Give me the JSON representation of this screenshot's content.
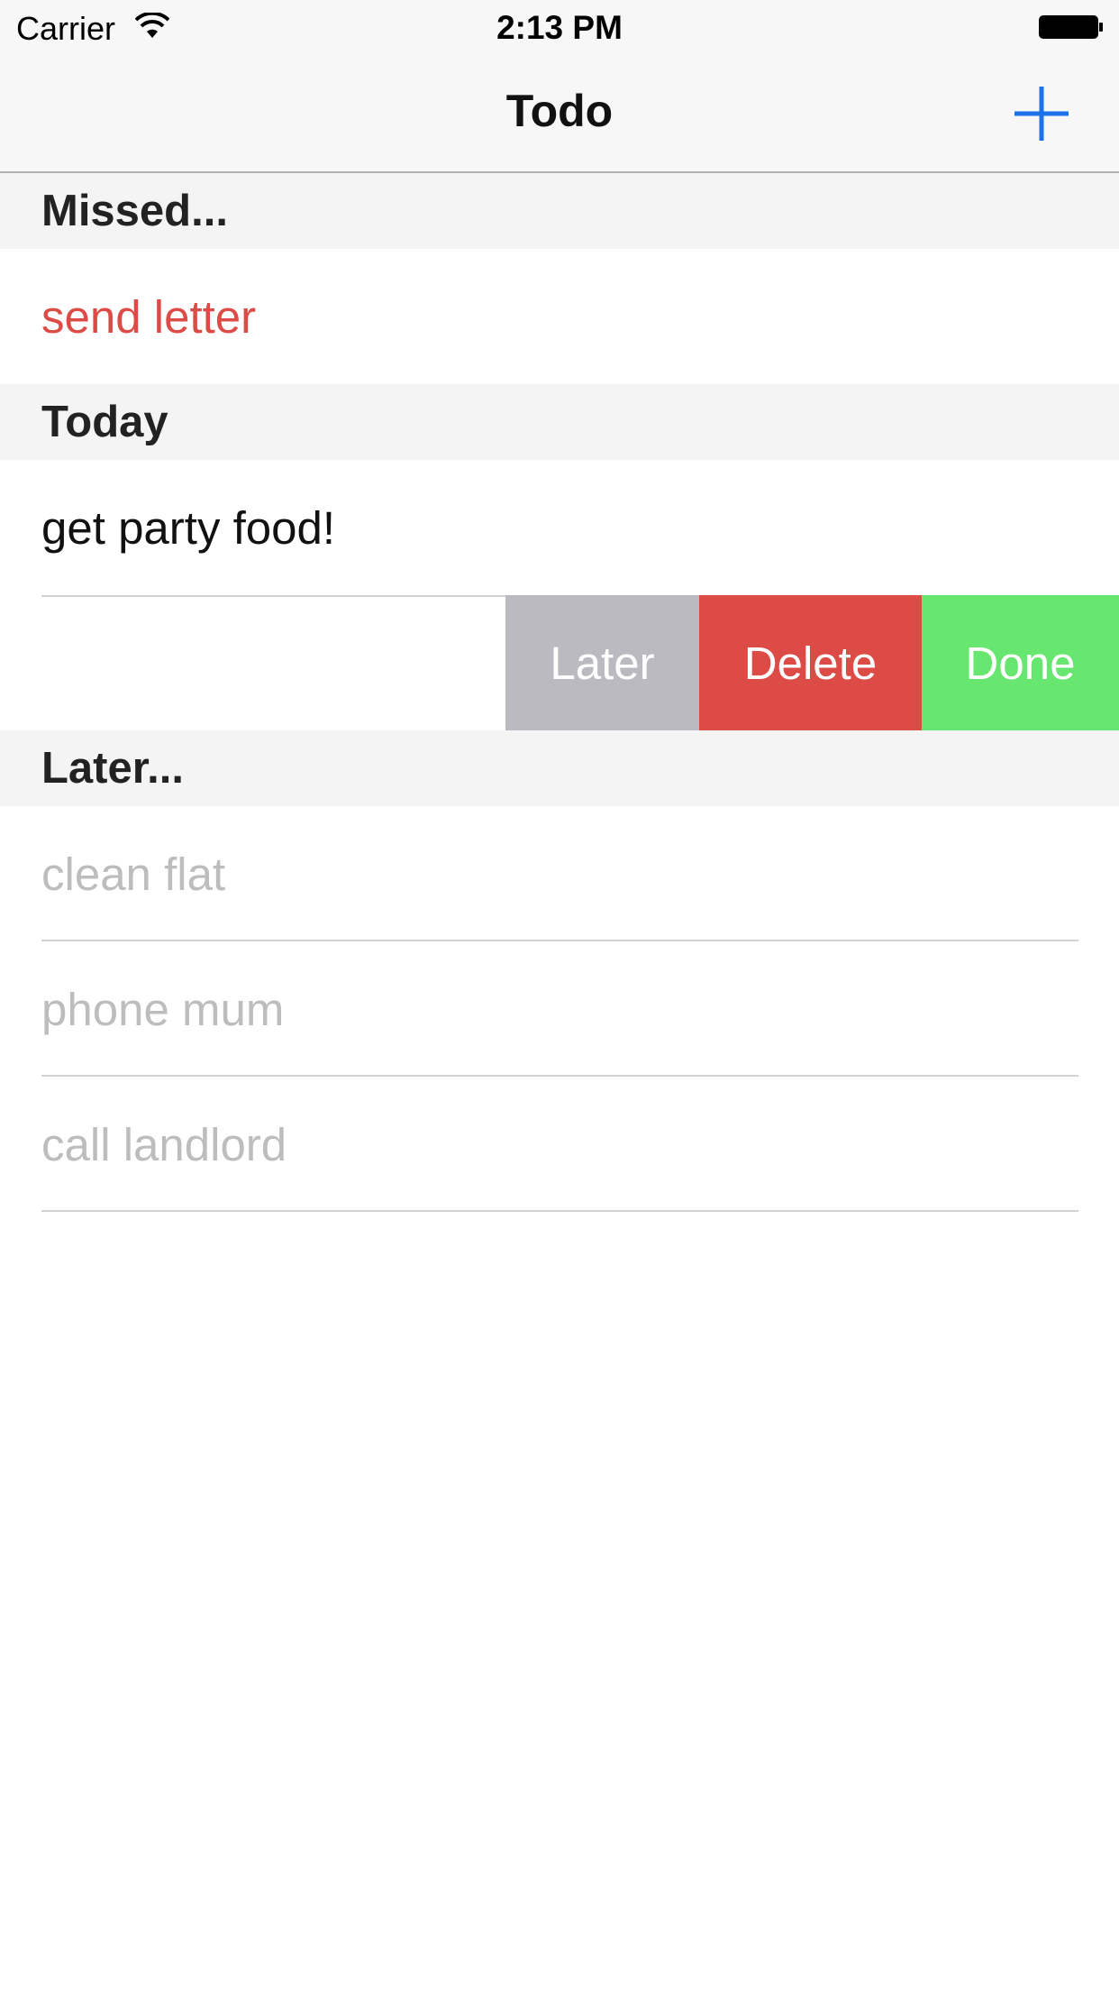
{
  "status_bar": {
    "carrier": "Carrier",
    "time": "2:13 PM",
    "wifi_icon": "wifi-icon",
    "battery_icon": "battery-icon"
  },
  "nav": {
    "title": "Todo",
    "add_icon": "plus-icon",
    "accent_color": "#1a73e8"
  },
  "sections": {
    "missed": {
      "header": "Missed...",
      "items": [
        "send letter"
      ],
      "color": "#dc4b46"
    },
    "today": {
      "header": "Today",
      "items": [
        "get party food!"
      ],
      "swipe_actions": [
        {
          "label": "Later",
          "color": "#bbbac1"
        },
        {
          "label": "Delete",
          "color": "#dc4b46"
        },
        {
          "label": "Done",
          "color": "#67e670"
        }
      ]
    },
    "later": {
      "header": "Later...",
      "items": [
        "clean flat",
        "phone mum",
        "call landlord"
      ],
      "color": "#bdbdbd"
    }
  }
}
